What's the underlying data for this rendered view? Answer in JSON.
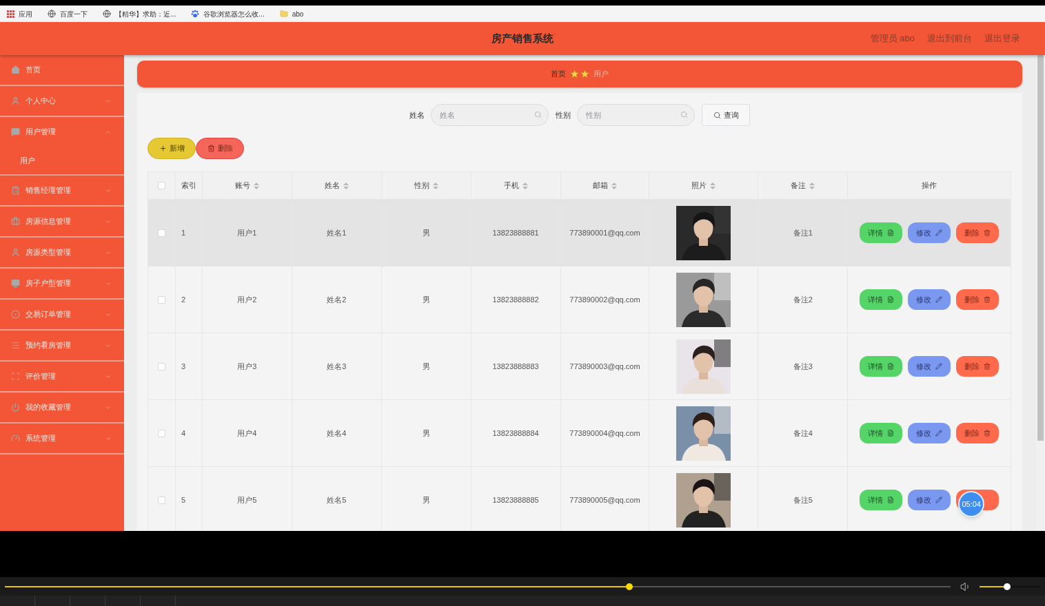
{
  "bookmarks": [
    {
      "kind": "apps",
      "label": "应用"
    },
    {
      "kind": "globe",
      "label": "百度一下"
    },
    {
      "kind": "globe",
      "label": "【精华】求助：近..."
    },
    {
      "kind": "paw",
      "label": "谷歌浏览器怎么收..."
    },
    {
      "kind": "folder",
      "label": "abo"
    }
  ],
  "header": {
    "title": "房产销售系统",
    "links": [
      "管理员 abo",
      "退出到前台",
      "退出登录"
    ]
  },
  "sidebar": {
    "items": [
      {
        "label": "首页"
      },
      {
        "label": "个人中心",
        "expanded": false
      },
      {
        "label": "用户管理",
        "expanded": true,
        "children": [
          {
            "label": "用户"
          }
        ]
      },
      {
        "label": "销售经理管理",
        "expanded": false
      },
      {
        "label": "房源信息管理",
        "expanded": false
      },
      {
        "label": "房源类型管理",
        "expanded": false
      },
      {
        "label": "房子户型管理",
        "expanded": false
      },
      {
        "label": "交易订单管理",
        "expanded": false
      },
      {
        "label": "预约看房管理",
        "expanded": false
      },
      {
        "label": "评价管理",
        "expanded": false
      },
      {
        "label": "我的收藏管理",
        "expanded": false
      },
      {
        "label": "系统管理",
        "expanded": false
      }
    ]
  },
  "breadcrumb": [
    "首页",
    "用户"
  ],
  "search": {
    "fields": [
      {
        "label": "姓名",
        "placeholder": "姓名"
      },
      {
        "label": "性别",
        "placeholder": "性别"
      }
    ],
    "button": "查询"
  },
  "actions": [
    {
      "kind": "add",
      "label": "新增"
    },
    {
      "kind": "delete",
      "label": "删除"
    }
  ],
  "table": {
    "select_all_checked": false,
    "columns": [
      {
        "label": "索引",
        "sortable": false
      },
      {
        "label": "账号",
        "sortable": true
      },
      {
        "label": "姓名",
        "sortable": true
      },
      {
        "label": "性别",
        "sortable": true
      },
      {
        "label": "手机",
        "sortable": true
      },
      {
        "label": "邮箱",
        "sortable": true
      },
      {
        "label": "照片",
        "sortable": true
      },
      {
        "label": "备注",
        "sortable": true
      },
      {
        "label": "操作",
        "sortable": false
      }
    ],
    "rows": [
      {
        "checked": false,
        "highlighted": true,
        "index": "1",
        "account": "用户1",
        "name": "姓名1",
        "gender": "男",
        "phone": "13823888881",
        "email": "773890001@qq.com",
        "note": "备注1",
        "actions": [
          {
            "kind": "detail",
            "label": "详情"
          },
          {
            "kind": "edit",
            "label": "修改"
          },
          {
            "kind": "delete",
            "label": "删除"
          }
        ]
      },
      {
        "checked": false,
        "highlighted": false,
        "index": "2",
        "account": "用户2",
        "name": "姓名2",
        "gender": "男",
        "phone": "13823888882",
        "email": "773890002@qq.com",
        "note": "备注2",
        "actions": [
          {
            "kind": "detail",
            "label": "详情"
          },
          {
            "kind": "edit",
            "label": "修改"
          },
          {
            "kind": "delete",
            "label": "删除"
          }
        ]
      },
      {
        "checked": false,
        "highlighted": false,
        "index": "3",
        "account": "用户3",
        "name": "姓名3",
        "gender": "男",
        "phone": "13823888883",
        "email": "773890003@qq.com",
        "note": "备注3",
        "actions": [
          {
            "kind": "detail",
            "label": "详情"
          },
          {
            "kind": "edit",
            "label": "修改"
          },
          {
            "kind": "delete",
            "label": "删除"
          }
        ]
      },
      {
        "checked": false,
        "highlighted": false,
        "index": "4",
        "account": "用户4",
        "name": "姓名4",
        "gender": "男",
        "phone": "13823888884",
        "email": "773890004@qq.com",
        "note": "备注4",
        "actions": [
          {
            "kind": "detail",
            "label": "详情"
          },
          {
            "kind": "edit",
            "label": "修改"
          },
          {
            "kind": "delete",
            "label": "删除"
          }
        ]
      },
      {
        "checked": false,
        "highlighted": false,
        "index": "5",
        "account": "用户5",
        "name": "姓名5",
        "gender": "男",
        "phone": "13823888885",
        "email": "773890005@qq.com",
        "note": "备注5",
        "actions": [
          {
            "kind": "detail",
            "label": "详情"
          },
          {
            "kind": "edit",
            "label": "修改"
          },
          {
            "kind": "delete"
          }
        ]
      }
    ]
  },
  "timer": "05:04",
  "player": {
    "progress": {
      "level": 0.66
    },
    "volume": {
      "level": 0.45
    }
  }
}
